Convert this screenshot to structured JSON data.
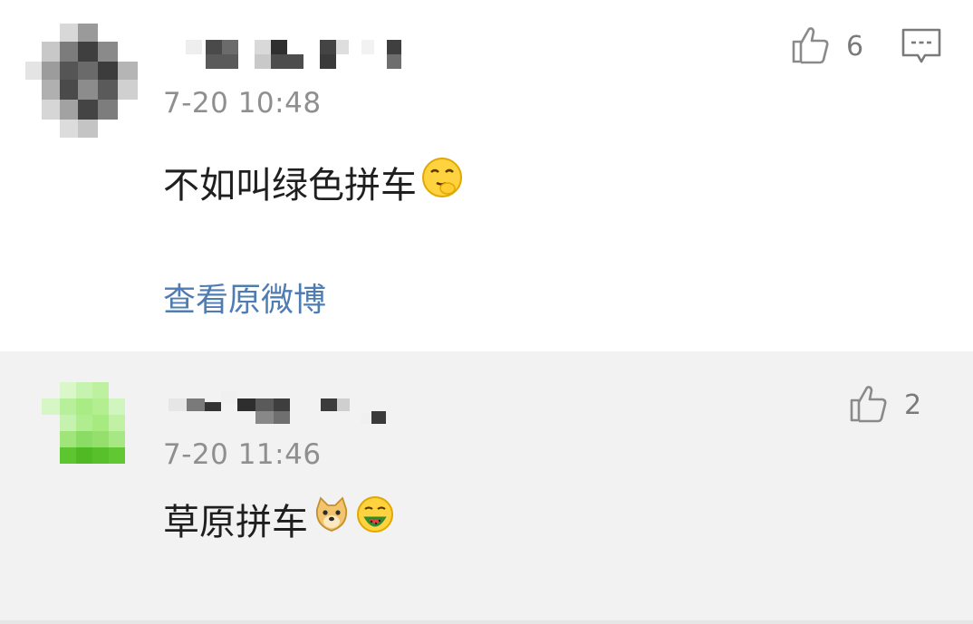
{
  "comments": [
    {
      "timestamp": "7-20 10:48",
      "text": "不如叫绿色拼车",
      "emojis": [
        "shush-face-emoji"
      ],
      "like_count": "6",
      "view_original_label": "查看原微博",
      "avatar_color": "#6b6b6b"
    },
    {
      "timestamp": "7-20 11:46",
      "text": "草原拼车",
      "emojis": [
        "doge-emoji",
        "watermelon-face-emoji"
      ],
      "like_count": "2",
      "avatar_color": "#7ed957"
    }
  ],
  "colors": {
    "link": "#4f7db3",
    "timestamp": "#8f8f8f",
    "text": "#1f1f1f",
    "reply_bg": "#f2f2f2"
  }
}
